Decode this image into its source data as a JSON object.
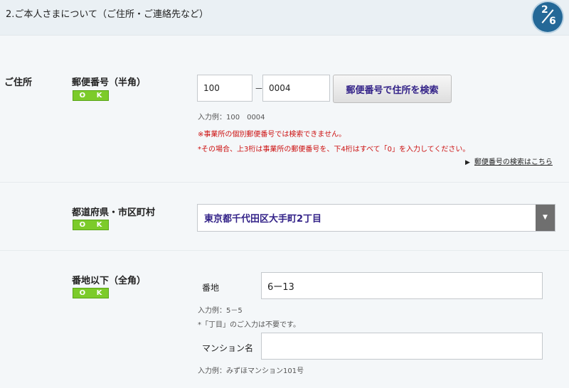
{
  "header": {
    "title": "2.ご本人さまについて（ご住所・ご連絡先など）",
    "step_current": "2",
    "step_total": "6"
  },
  "address_section": {
    "label": "ご住所"
  },
  "postal": {
    "label": "郵便番号（半角）",
    "status": "O K",
    "value1": "100",
    "separator": "－",
    "value2": "0004",
    "search_button": "郵便番号で住所を検索",
    "example": "入力例：100　0004",
    "warning1": "※事業所の個別郵便番号では検索できません。",
    "warning2": "*その場合、上3桁は事業所の郵便番号を、下4桁はすべて「0」を入力してください。",
    "lookup_link": "郵便番号の検索はこちら",
    "lookup_arrow": "▶"
  },
  "prefecture": {
    "label": "都道府県・市区町村",
    "status": "O K",
    "selected": "東京都千代田区大手町2丁目",
    "dropdown_glyph": "▼"
  },
  "street": {
    "label": "番地以下（全角）",
    "status": "O K",
    "banchi_label": "番地",
    "banchi_value": "6ー13",
    "banchi_example": "入力例：5－5",
    "banchi_note": "*「丁目」のご入力は不要です。",
    "building_label": "マンション名",
    "building_value": "",
    "building_example": "入力例：みずほマンション101号"
  }
}
